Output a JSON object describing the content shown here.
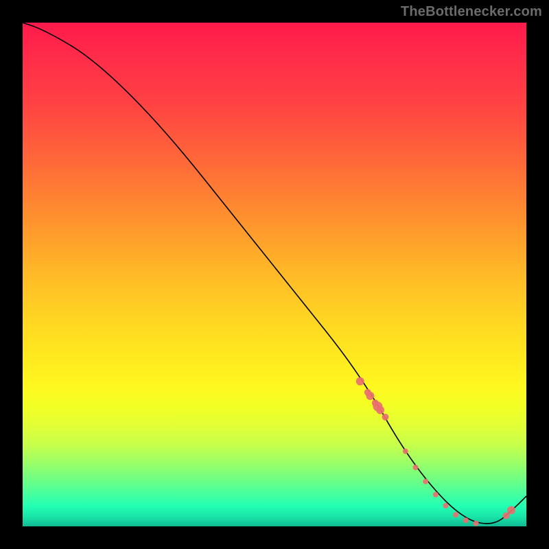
{
  "attribution": "TheBottlenecker.com",
  "chart_data": {
    "type": "line",
    "title": "",
    "xlabel": "",
    "ylabel": "",
    "xlim": [
      0,
      100
    ],
    "ylim": [
      0,
      100
    ],
    "x": [
      0,
      3,
      7,
      12,
      18,
      25,
      32,
      40,
      48,
      56,
      64,
      70,
      74,
      78,
      82,
      86,
      90,
      94,
      97,
      100
    ],
    "values": [
      100,
      99,
      97,
      94,
      89,
      82,
      74,
      64,
      54,
      44,
      34,
      25,
      18,
      12,
      7,
      3,
      0.6,
      0.5,
      3,
      6
    ],
    "markers": {
      "x": [
        67,
        68.5,
        69,
        70,
        70.5,
        71,
        72,
        76,
        78,
        80,
        82,
        84,
        86,
        88,
        90,
        96,
        97
      ],
      "y": [
        28.8,
        26.6,
        25.9,
        24.5,
        23.8,
        23.1,
        21.7,
        14.9,
        11.7,
        8.9,
        6.3,
        4.1,
        2.3,
        1.2,
        0.6,
        2.1,
        3.2
      ],
      "size": [
        6,
        5,
        6,
        5,
        7,
        6,
        5,
        4,
        4,
        4,
        4,
        4,
        4,
        4,
        4,
        5,
        6
      ]
    },
    "gradient_stops": [
      {
        "offset": 0,
        "color": "#ff1a4b"
      },
      {
        "offset": 16,
        "color": "#ff4243"
      },
      {
        "offset": 38,
        "color": "#ff8e2f"
      },
      {
        "offset": 58,
        "color": "#ffd322"
      },
      {
        "offset": 76,
        "color": "#e2ff36"
      },
      {
        "offset": 90,
        "color": "#78ff7e"
      },
      {
        "offset": 100,
        "color": "#10bb93"
      }
    ],
    "curve_color": "#000000",
    "marker_color": "#e97070"
  }
}
